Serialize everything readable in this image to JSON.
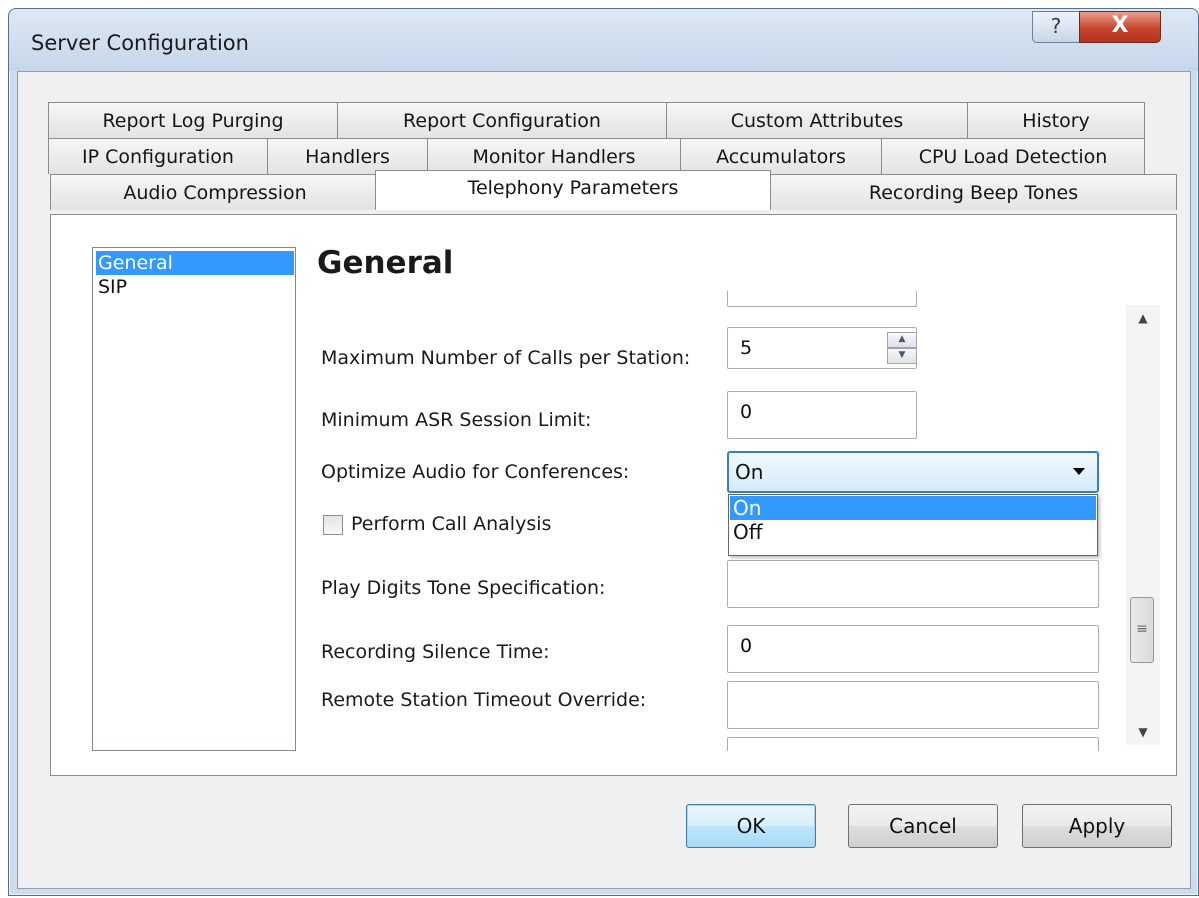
{
  "window": {
    "title": "Server Configuration",
    "help_glyph": "?",
    "close_glyph": "X"
  },
  "tabs": {
    "row1": [
      "Report Log Purging",
      "Report Configuration",
      "Custom Attributes",
      "History"
    ],
    "row2": [
      "IP Configuration",
      "Handlers",
      "Monitor Handlers",
      "Accumulators",
      "CPU Load Detection"
    ],
    "row3": [
      "Audio Compression",
      "Telephony Parameters",
      "Recording Beep Tones"
    ],
    "active": "Telephony Parameters"
  },
  "nav": {
    "items": [
      "General",
      "SIP"
    ],
    "selected": "General"
  },
  "section": {
    "heading": "General"
  },
  "fields": {
    "max_calls_label": "Maximum Number of Calls per Station:",
    "max_calls_value": "5",
    "min_asr_label": "Minimum ASR Session Limit:",
    "min_asr_value": "0",
    "optimize_label": "Optimize Audio for Conferences:",
    "optimize_value": "On",
    "optimize_options": [
      "On",
      "Off"
    ],
    "optimize_highlighted": "On",
    "call_analysis_label": "Perform Call Analysis",
    "call_analysis_checked": false,
    "play_digits_label": "Play Digits Tone Specification:",
    "play_digits_value": "",
    "silence_label": "Recording Silence Time:",
    "silence_value": "0",
    "remote_timeout_label": "Remote Station Timeout Override:",
    "remote_timeout_value": ""
  },
  "scrollbar": {
    "up_glyph": "▲",
    "down_glyph": "▼",
    "thumb_glyph": "≡"
  },
  "buttons": {
    "ok": "OK",
    "cancel": "Cancel",
    "apply": "Apply"
  },
  "colors": {
    "selection": "#3399ff",
    "combo_focus_border": "#3c7fb1",
    "close_button": "#c8432c"
  }
}
